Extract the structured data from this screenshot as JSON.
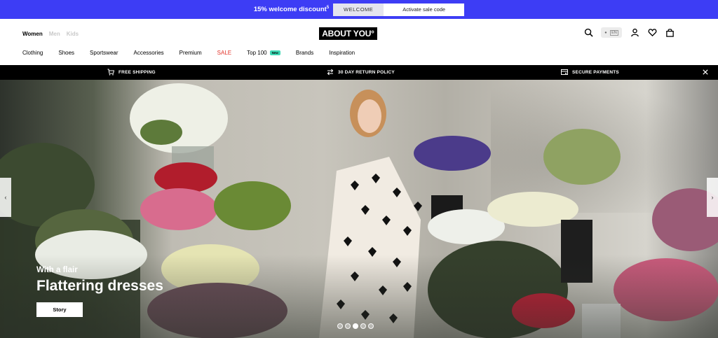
{
  "promo": {
    "text": "15% welcome discount",
    "footnote": "5",
    "code": "WELCOME",
    "activate_label": "Activate sale code",
    "background": "#3d3df5"
  },
  "header": {
    "genders": [
      "Women",
      "Men",
      "Kids"
    ],
    "logo": "ABOUT YOU°",
    "icons": [
      "search-icon",
      "language-toggle",
      "account-icon",
      "heart-icon",
      "bag-icon"
    ],
    "language_pill": {
      "dot": "●",
      "code": "EN"
    },
    "nav": [
      "Clothing",
      "Shoes",
      "Sportswear",
      "Accessories",
      "Premium",
      "SALE",
      "Top 100",
      "Brands",
      "Inspiration"
    ],
    "top100_badge": "New",
    "sale_color": "#e2332a",
    "badge_color": "#3ed8b4"
  },
  "usp": {
    "items": [
      "FREE SHIPPING",
      "30 DAY RETURN POLICY",
      "SECURE PAYMENTS"
    ],
    "close_icon": "close-icon"
  },
  "hero": {
    "subtitle": "With a flair",
    "title": "Flattering dresses",
    "cta": "Story",
    "prev": "‹",
    "next": "›",
    "slide_count": 5,
    "active_slide": 3
  }
}
